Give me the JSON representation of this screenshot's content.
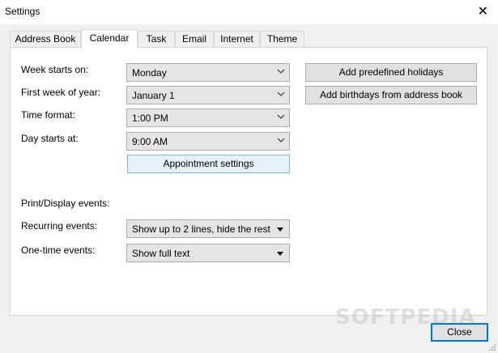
{
  "window": {
    "title": "Settings",
    "close_glyph": "✕"
  },
  "tabs": [
    {
      "label": "Address Book",
      "active": false
    },
    {
      "label": "Calendar",
      "active": true
    },
    {
      "label": "Task",
      "active": false
    },
    {
      "label": "Email",
      "active": false
    },
    {
      "label": "Internet",
      "active": false
    },
    {
      "label": "Theme",
      "active": false
    }
  ],
  "calendar": {
    "week_starts_label": "Week starts on:",
    "week_starts_value": "Monday",
    "first_week_label": "First week of year:",
    "first_week_value": "January 1",
    "time_format_label": "Time format:",
    "time_format_value": "1:00 PM",
    "day_starts_label": "Day starts at:",
    "day_starts_value": "9:00 AM",
    "appointment_settings": "Appointment settings",
    "add_holidays": "Add predefined holidays",
    "add_birthdays": "Add birthdays from address book",
    "print_display_label": "Print/Display events:",
    "recurring_label": "Recurring events:",
    "recurring_value": "Show up to 2 lines, hide the rest",
    "onetime_label": "One-time events:",
    "onetime_value": "Show full text"
  },
  "footer": {
    "close_label": "Close",
    "watermark": "SOFTPEDIA"
  }
}
